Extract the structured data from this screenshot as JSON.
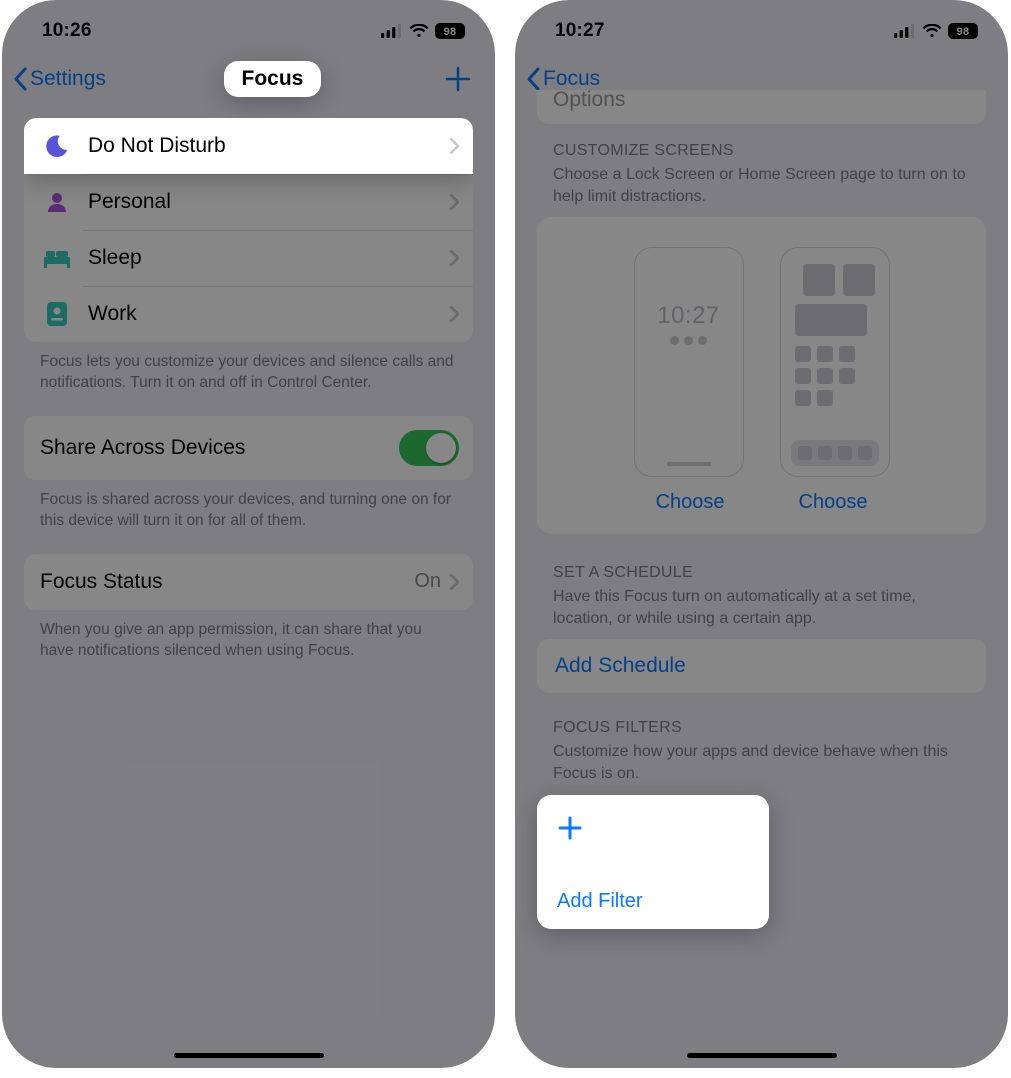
{
  "left": {
    "status_time": "10:26",
    "battery_pct": "98",
    "nav_back": "Settings",
    "nav_title": "Focus",
    "modes": [
      {
        "label": "Do Not Disturb"
      },
      {
        "label": "Personal"
      },
      {
        "label": "Sleep"
      },
      {
        "label": "Work"
      }
    ],
    "modes_footer": "Focus lets you customize your devices and silence calls and notifications. Turn it on and off in Control Center.",
    "share_label": "Share Across Devices",
    "share_footer": "Focus is shared across your devices, and turning one on for this device will turn it on for all of them.",
    "status_label": "Focus Status",
    "status_value": "On",
    "status_footer": "When you give an app permission, it can share that you have notifications silenced when using Focus."
  },
  "right": {
    "status_time": "10:27",
    "battery_pct": "98",
    "nav_back": "Focus",
    "options_label": "Options",
    "cust_header": "CUSTOMIZE SCREENS",
    "cust_sub": "Choose a Lock Screen or Home Screen page to turn on to help limit distractions.",
    "lock_time": "10:27",
    "choose": "Choose",
    "sched_header": "SET A SCHEDULE",
    "sched_sub": "Have this Focus turn on automatically at a set time, location, or while using a certain app.",
    "add_schedule": "Add Schedule",
    "filters_header": "FOCUS FILTERS",
    "filters_sub": "Customize how your apps and device behave when this Focus is on.",
    "add_filter": "Add Filter"
  }
}
